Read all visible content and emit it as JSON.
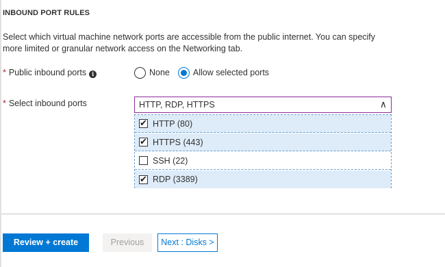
{
  "section": {
    "title": "INBOUND PORT RULES",
    "description": "Select which virtual machine network ports are accessible from the public internet. You can specify more limited or granular network access on the Networking tab."
  },
  "public_inbound_ports": {
    "label": "Public inbound ports",
    "required_marker": "*",
    "info_glyph": "i",
    "options": [
      {
        "label": "None",
        "checked": false
      },
      {
        "label": "Allow selected ports",
        "checked": true
      }
    ]
  },
  "select_inbound_ports": {
    "label": "Select inbound ports",
    "required_marker": "*",
    "value": "HTTP, RDP, HTTPS",
    "chevron": "∧",
    "options": [
      {
        "label": "HTTP (80)",
        "checked": true,
        "mark": "✔"
      },
      {
        "label": "HTTPS (443)",
        "checked": true,
        "mark": "✔"
      },
      {
        "label": "SSH (22)",
        "checked": false,
        "mark": ""
      },
      {
        "label": "RDP (3389)",
        "checked": true,
        "mark": "✔"
      }
    ]
  },
  "footer": {
    "review_create_label": "Review + create",
    "previous_label": "Previous",
    "next_label": "Next : Disks >"
  },
  "colors": {
    "accent": "#0078d4",
    "required": "#a4262c",
    "dropdown_border": "#8a2d9a",
    "selected_option_bg": "#deecf9"
  }
}
